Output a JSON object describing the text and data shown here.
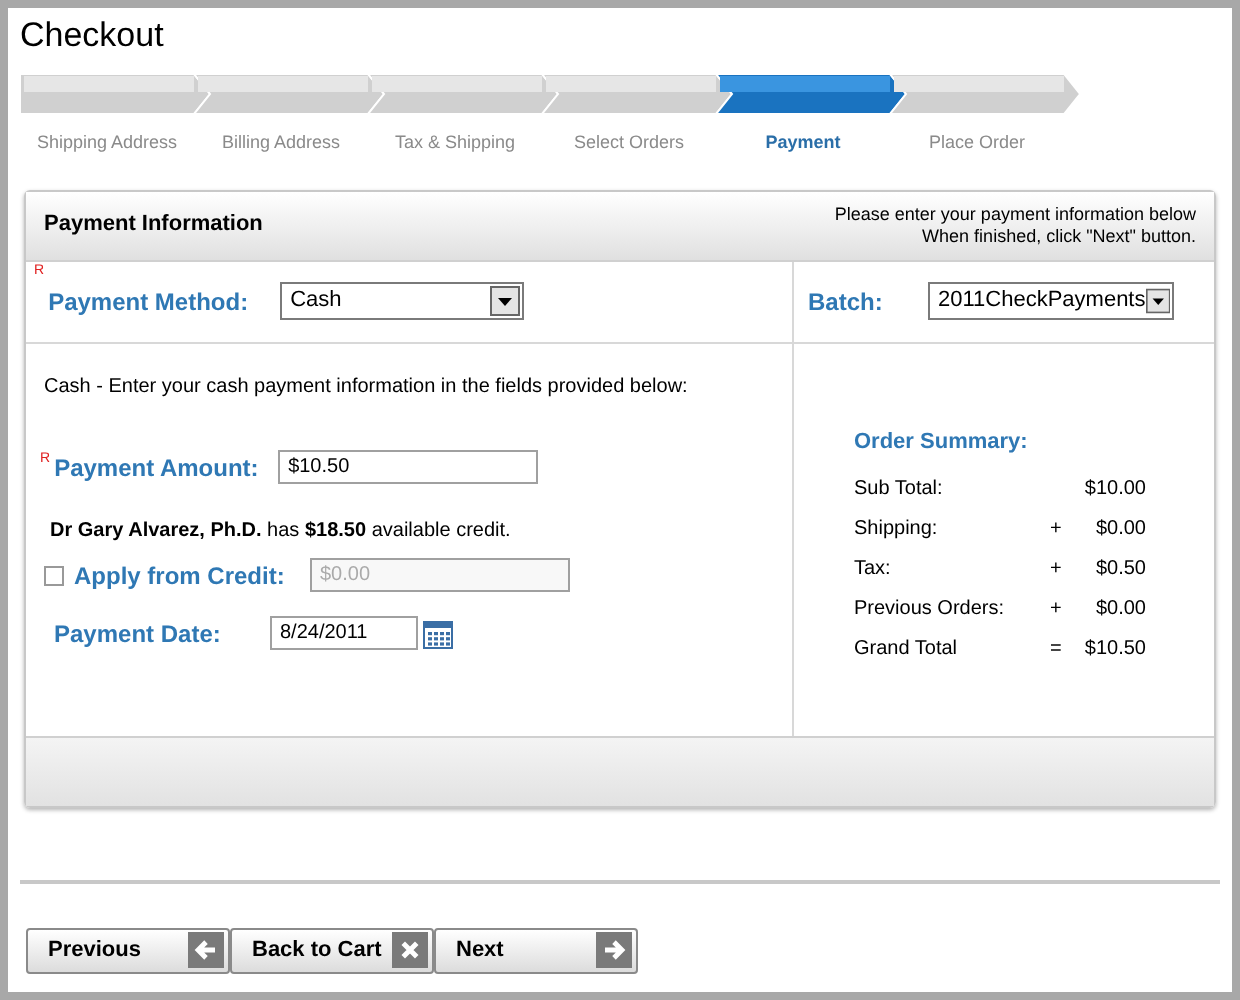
{
  "title": "Checkout",
  "steps": [
    {
      "label": "Shipping Address",
      "selected": false
    },
    {
      "label": "Billing Address",
      "selected": false
    },
    {
      "label": "Tax & Shipping",
      "selected": false
    },
    {
      "label": "Select Orders",
      "selected": false
    },
    {
      "label": "Payment",
      "selected": true
    },
    {
      "label": "Place Order",
      "selected": false
    }
  ],
  "panel": {
    "title": "Payment Information",
    "instructions": [
      "Please enter your payment information below",
      "When finished, click \"Next\" button."
    ],
    "payment_method": {
      "required_mark": "R",
      "label": "Payment Method:",
      "value": "Cash"
    },
    "batch": {
      "label": "Batch:",
      "value": "2011CheckPayments"
    },
    "description": "Cash - Enter your cash payment information in the fields provided below:",
    "payment_amount": {
      "required_mark": "R",
      "label": "Payment Amount:",
      "value": "$10.50"
    },
    "credit_note": "**Dr Gary Alvarez, Ph.D.** has **$18.50** available credit.",
    "apply_credit": {
      "label": "Apply from Credit:",
      "checked": false,
      "value": "$0.00",
      "disabled": true
    },
    "payment_date": {
      "label": "Payment Date:",
      "value": "8/24/2011"
    },
    "order_summary": {
      "title": "Order Summary:",
      "rows": [
        {
          "label": "Sub Total:",
          "amount": "$10.00"
        },
        {
          "label": "Shipping:",
          "operator": "+",
          "amount": "$0.00"
        },
        {
          "label": "Tax:",
          "operator": "+",
          "amount": "$0.50"
        },
        {
          "label": "Previous Orders:",
          "operator": "+",
          "amount": "$0.00"
        },
        {
          "label": "Grand Total",
          "operator": "=",
          "amount": "$10.50"
        }
      ]
    }
  },
  "buttons": [
    {
      "label": "Previous",
      "kind": "back"
    },
    {
      "label": "Back to Cart",
      "kind": "cancel"
    },
    {
      "label": "Next",
      "kind": "forward"
    }
  ]
}
